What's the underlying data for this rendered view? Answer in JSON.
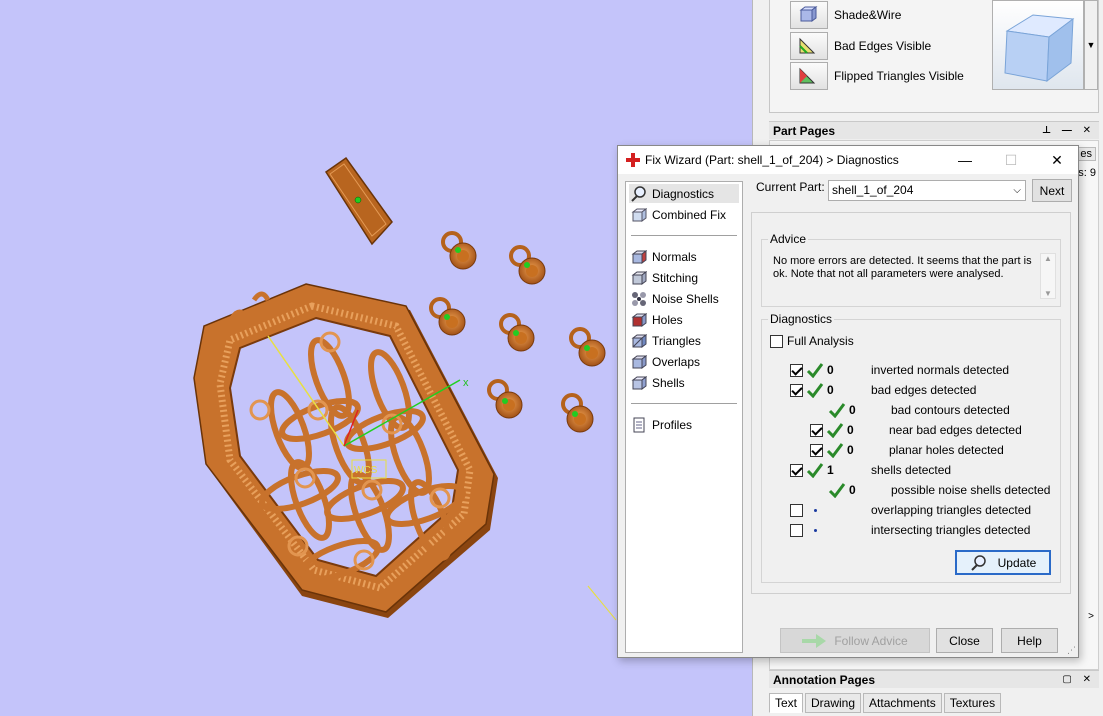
{
  "viewport": {
    "axis_x_label": "x",
    "label_box_text": "WCS"
  },
  "view_panel": {
    "rows": [
      {
        "label": "Shade&Wire",
        "icon": "shade-wire-icon"
      },
      {
        "label": "Bad Edges Visible",
        "icon": "bad-edges-icon"
      },
      {
        "label": "Flipped Triangles Visible",
        "icon": "flipped-triangles-icon"
      }
    ]
  },
  "part_pages": {
    "title": "Part Pages",
    "hidden_tab_fragment": "es",
    "hidden_count_fragment": "s: 9"
  },
  "annotation_pages": {
    "title": "Annotation Pages",
    "tabs": [
      "Text",
      "Drawing",
      "Attachments",
      "Textures"
    ]
  },
  "wizard": {
    "title": "Fix Wizard (Part: shell_1_of_204) > Diagnostics",
    "nav": {
      "group1": [
        {
          "label": "Diagnostics",
          "icon": "magnifier-icon",
          "selected": true
        },
        {
          "label": "Combined Fix",
          "icon": "cube-icon",
          "selected": false
        }
      ],
      "group2": [
        {
          "label": "Normals",
          "icon": "normals-icon"
        },
        {
          "label": "Stitching",
          "icon": "stitching-icon"
        },
        {
          "label": "Noise Shells",
          "icon": "noise-shells-icon"
        },
        {
          "label": "Holes",
          "icon": "holes-icon"
        },
        {
          "label": "Triangles",
          "icon": "triangles-icon"
        },
        {
          "label": "Overlaps",
          "icon": "overlaps-icon"
        },
        {
          "label": "Shells",
          "icon": "shells-icon"
        }
      ],
      "group3": [
        {
          "label": "Profiles",
          "icon": "profiles-icon"
        }
      ]
    },
    "current_part_label": "Current Part:",
    "current_part_value": "shell_1_of_204",
    "next_label": "Next",
    "advice": {
      "label": "Advice",
      "text": "No more errors are detected. It seems that the part is ok. Note that not all parameters were analysed."
    },
    "diagnostics": {
      "label": "Diagnostics",
      "full_analysis_label": "Full Analysis",
      "rows": [
        {
          "checkbox": true,
          "checked": true,
          "status": "ok",
          "count": "0",
          "text": "inverted normals detected",
          "indent": 0
        },
        {
          "checkbox": true,
          "checked": true,
          "status": "ok",
          "count": "0",
          "text": "bad edges detected",
          "indent": 0
        },
        {
          "checkbox": false,
          "checked": false,
          "status": "ok",
          "count": "0",
          "text": "bad contours detected",
          "indent": 2
        },
        {
          "checkbox": true,
          "checked": true,
          "status": "ok",
          "count": "0",
          "text": "near bad edges detected",
          "indent": 1
        },
        {
          "checkbox": true,
          "checked": true,
          "status": "ok",
          "count": "0",
          "text": "planar holes detected",
          "indent": 1
        },
        {
          "checkbox": true,
          "checked": true,
          "status": "ok",
          "count": "1",
          "text": "shells detected",
          "indent": 0
        },
        {
          "checkbox": false,
          "checked": false,
          "status": "ok",
          "count": "0",
          "text": "possible noise shells detected",
          "indent": 2
        },
        {
          "checkbox": true,
          "checked": false,
          "status": "unknown",
          "count": "",
          "text": "overlapping triangles detected",
          "indent": 0
        },
        {
          "checkbox": true,
          "checked": false,
          "status": "unknown",
          "count": "",
          "text": "intersecting triangles detected",
          "indent": 0
        }
      ],
      "update_label": "Update"
    },
    "follow_advice_label": "Follow Advice",
    "close_label": "Close",
    "help_label": "Help"
  },
  "colors": {
    "viewport_bg": "#c4c4fa",
    "part_orange": "#c8702a",
    "ok_green": "#2a8a2a"
  }
}
